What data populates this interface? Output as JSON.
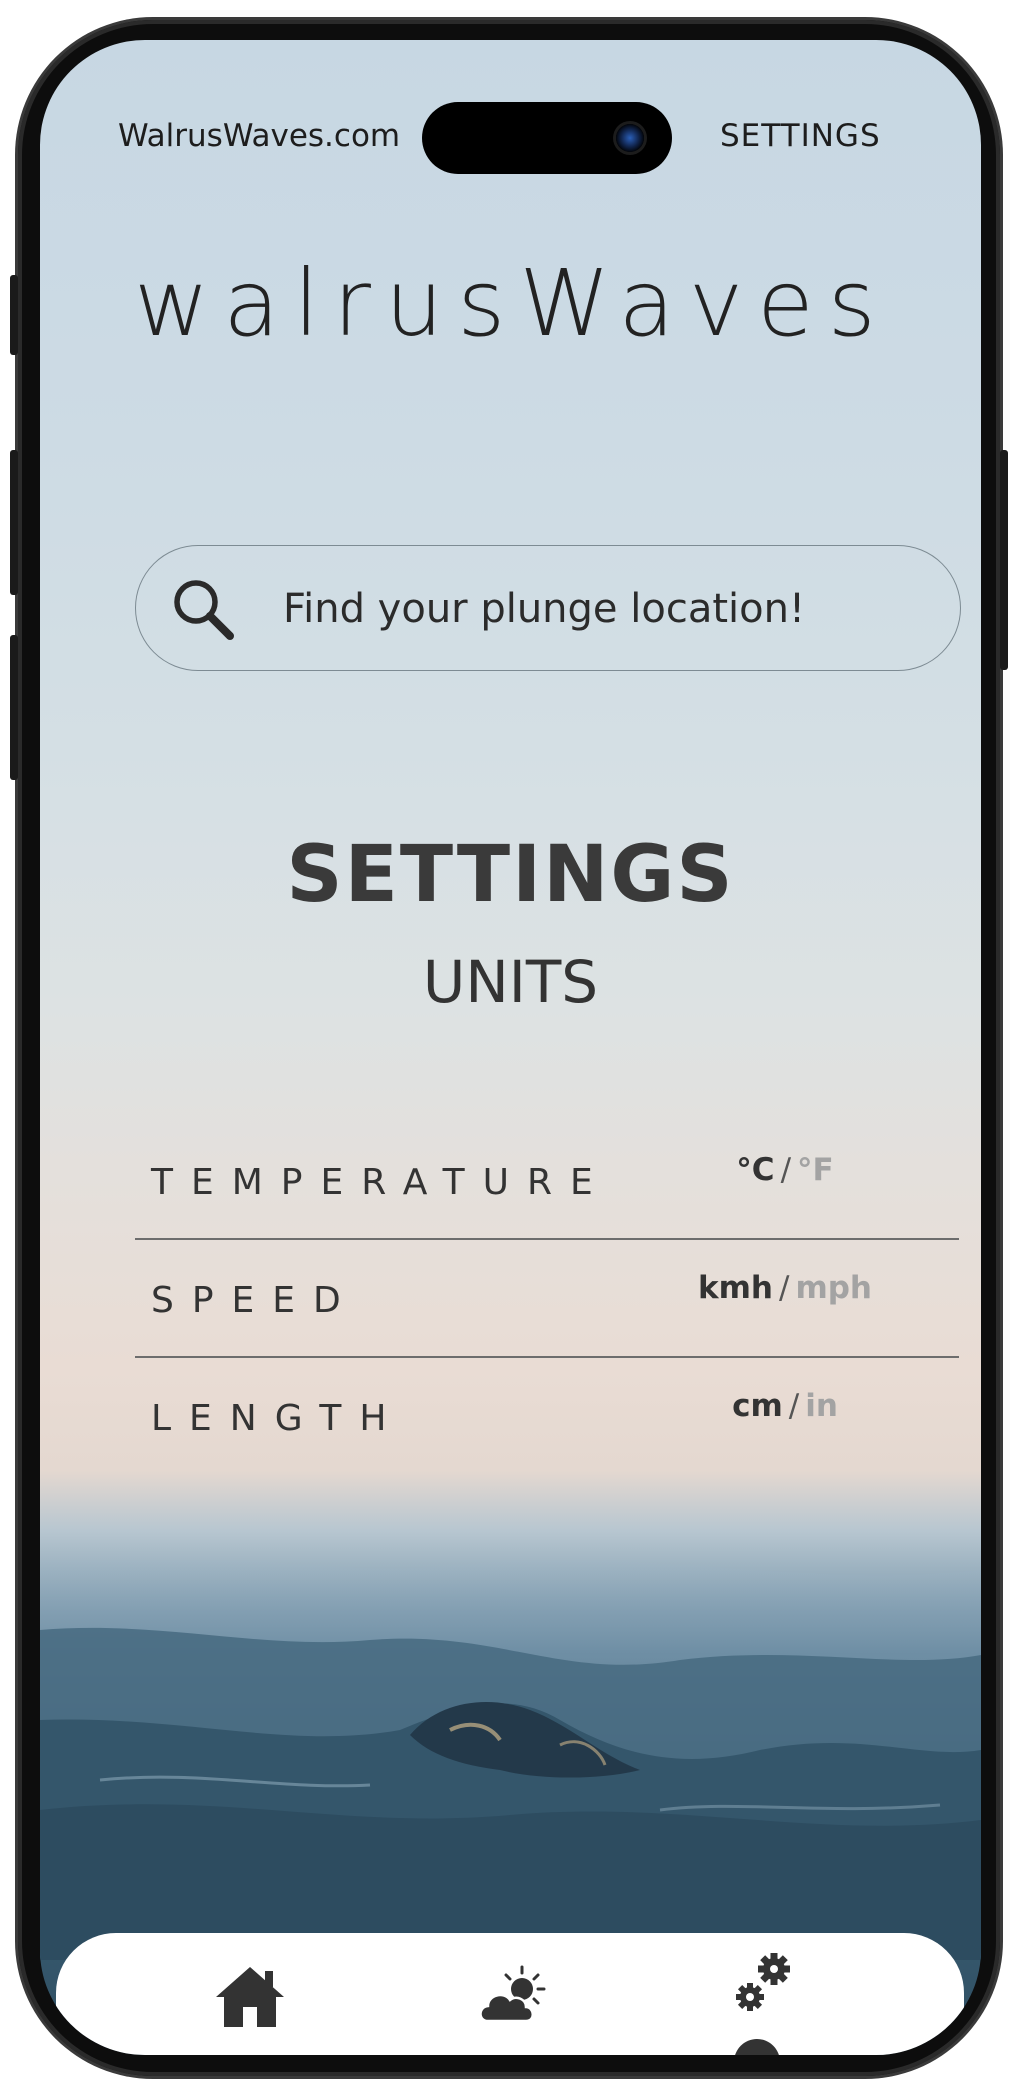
{
  "status_bar": {
    "site": "WalrusWaves.com",
    "page": "SETTINGS"
  },
  "brand": "walrusWaves",
  "search": {
    "placeholder": "Find your plunge location!",
    "icon": "search-icon"
  },
  "main": {
    "title": "SETTINGS",
    "subtitle": "UNITS",
    "rows": [
      {
        "label": "TEMPERATURE",
        "selected": "°C",
        "separator": "/",
        "other": "°F"
      },
      {
        "label": "SPEED",
        "selected": "kmh",
        "separator": "/",
        "other": "mph"
      },
      {
        "label": "LENGTH",
        "selected": "cm",
        "separator": "/",
        "other": "in"
      }
    ]
  },
  "nav": {
    "items": [
      {
        "icon": "home-icon"
      },
      {
        "icon": "weather-icon"
      },
      {
        "icon": "settings-icon",
        "active": true
      }
    ]
  },
  "colors": {
    "text_dark": "#333333",
    "unit_inactive": "#a3a3a3",
    "nav_background": "#ffffff"
  }
}
